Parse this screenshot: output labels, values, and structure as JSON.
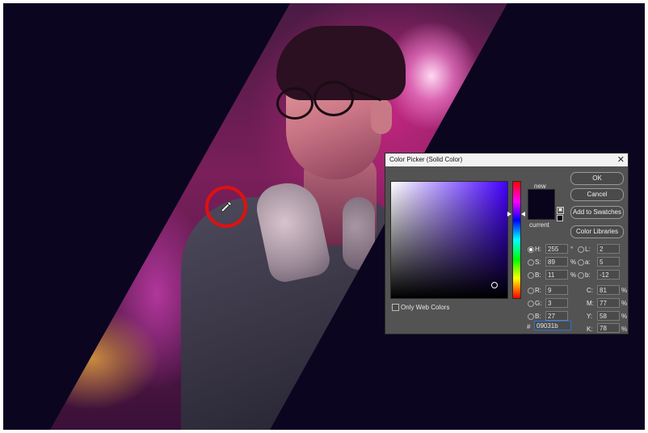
{
  "dialog": {
    "title": "Color Picker (Solid Color)",
    "close_glyph": "✕",
    "new_label": "new",
    "current_label": "current",
    "new_color": "#09031b",
    "current_color": "#09031b",
    "buttons": {
      "ok": "OK",
      "cancel": "Cancel",
      "add_to_swatches": "Add to Swatches",
      "color_libraries": "Color Libraries"
    },
    "hsb": [
      {
        "label": "H:",
        "value": "255",
        "unit": "°",
        "selected": true
      },
      {
        "label": "S:",
        "value": "89",
        "unit": "%"
      },
      {
        "label": "B:",
        "value": "11",
        "unit": "%"
      }
    ],
    "rgb": [
      {
        "label": "R:",
        "value": "9"
      },
      {
        "label": "G:",
        "value": "3"
      },
      {
        "label": "B:",
        "value": "27"
      }
    ],
    "lab": [
      {
        "label": "L:",
        "value": "2"
      },
      {
        "label": "a:",
        "value": "5"
      },
      {
        "label": "b:",
        "value": "-12"
      }
    ],
    "cmyk": [
      {
        "label": "C:",
        "value": "81",
        "unit": "%"
      },
      {
        "label": "M:",
        "value": "77",
        "unit": "%"
      },
      {
        "label": "Y:",
        "value": "58",
        "unit": "%"
      },
      {
        "label": "K:",
        "value": "78",
        "unit": "%"
      }
    ],
    "only_web_colors_label": "Only Web Colors",
    "hash_label": "#",
    "hex_value": "09031b"
  },
  "icons": {
    "eyedropper": "eyedropper-icon",
    "gamut_warning": "cube-warning-icon",
    "web_safe": "web-safe-swatch-icon"
  },
  "colors": {
    "canvas_background": "#0b0520",
    "highlight_ring": "#e01010",
    "dialog_background": "#535353"
  }
}
